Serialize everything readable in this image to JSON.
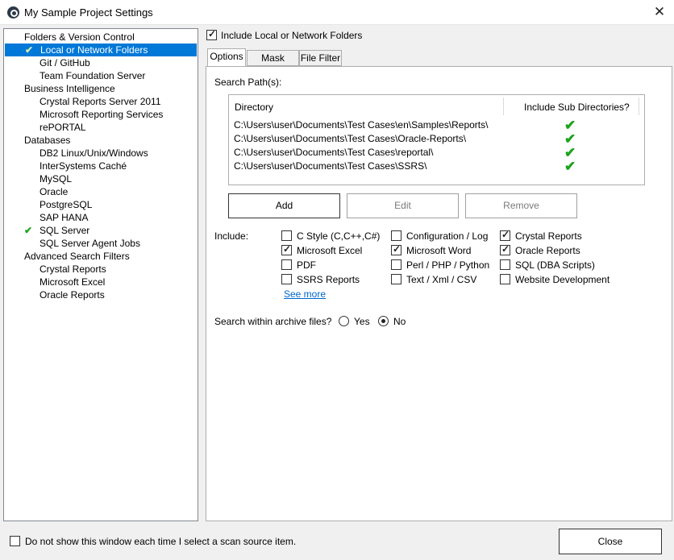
{
  "window": {
    "title": "My Sample Project Settings",
    "close_glyph": "✕"
  },
  "tree": {
    "items": [
      {
        "label": "Folders & Version Control",
        "level": 0,
        "selected": false,
        "checked": false
      },
      {
        "label": "Local or Network Folders",
        "level": 1,
        "selected": true,
        "checked": true
      },
      {
        "label": "Git / GitHub",
        "level": 1,
        "selected": false,
        "checked": false
      },
      {
        "label": "Team Foundation Server",
        "level": 1,
        "selected": false,
        "checked": false
      },
      {
        "label": "Business Intelligence",
        "level": 0,
        "selected": false,
        "checked": false
      },
      {
        "label": "Crystal Reports Server 2011",
        "level": 1,
        "selected": false,
        "checked": false
      },
      {
        "label": "Microsoft Reporting Services",
        "level": 1,
        "selected": false,
        "checked": false
      },
      {
        "label": "rePORTAL",
        "level": 1,
        "selected": false,
        "checked": false
      },
      {
        "label": "Databases",
        "level": 0,
        "selected": false,
        "checked": false
      },
      {
        "label": "DB2 Linux/Unix/Windows",
        "level": 1,
        "selected": false,
        "checked": false
      },
      {
        "label": "InterSystems Caché",
        "level": 1,
        "selected": false,
        "checked": false
      },
      {
        "label": "MySQL",
        "level": 1,
        "selected": false,
        "checked": false
      },
      {
        "label": "Oracle",
        "level": 1,
        "selected": false,
        "checked": false
      },
      {
        "label": "PostgreSQL",
        "level": 1,
        "selected": false,
        "checked": false
      },
      {
        "label": "SAP HANA",
        "level": 1,
        "selected": false,
        "checked": false
      },
      {
        "label": "SQL Server",
        "level": 1,
        "selected": false,
        "checked": true
      },
      {
        "label": "SQL Server Agent Jobs",
        "level": 1,
        "selected": false,
        "checked": false
      },
      {
        "label": "Advanced Search Filters",
        "level": 0,
        "selected": false,
        "checked": false
      },
      {
        "label": "Crystal Reports",
        "level": 1,
        "selected": false,
        "checked": false
      },
      {
        "label": "Microsoft Excel",
        "level": 1,
        "selected": false,
        "checked": false
      },
      {
        "label": "Oracle Reports",
        "level": 1,
        "selected": false,
        "checked": false
      }
    ]
  },
  "include_local": {
    "label": "Include Local or Network Folders",
    "checked": true
  },
  "tabs": [
    {
      "label": "Options",
      "active": true
    },
    {
      "label": "Mask Filters",
      "active": false
    },
    {
      "label": "File Filter",
      "active": false
    }
  ],
  "search_paths": {
    "label": "Search Path(s):",
    "columns": [
      "Directory",
      "Include Sub Directories?"
    ],
    "rows": [
      {
        "path": "C:\\Users\\user\\Documents\\Test Cases\\en\\Samples\\Reports\\",
        "sub": true
      },
      {
        "path": "C:\\Users\\user\\Documents\\Test Cases\\Oracle-Reports\\",
        "sub": true
      },
      {
        "path": "C:\\Users\\user\\Documents\\Test Cases\\reportal\\",
        "sub": true
      },
      {
        "path": "C:\\Users\\user\\Documents\\Test Cases\\SSRS\\",
        "sub": true
      }
    ]
  },
  "buttons": {
    "add": "Add",
    "edit": "Edit",
    "remove": "Remove",
    "close": "Close"
  },
  "include": {
    "label": "Include:",
    "options": [
      {
        "label": "C Style (C,C++,C#)",
        "checked": false
      },
      {
        "label": "Configuration / Log",
        "checked": false
      },
      {
        "label": "Crystal Reports",
        "checked": true
      },
      {
        "label": "Microsoft Excel",
        "checked": true
      },
      {
        "label": "Microsoft Word",
        "checked": true
      },
      {
        "label": "Oracle Reports",
        "checked": true
      },
      {
        "label": "PDF",
        "checked": false
      },
      {
        "label": "Perl / PHP / Python",
        "checked": false
      },
      {
        "label": "SQL (DBA Scripts)",
        "checked": false
      },
      {
        "label": "SSRS Reports",
        "checked": false
      },
      {
        "label": "Text / Xml / CSV",
        "checked": false
      },
      {
        "label": "Website Development",
        "checked": false
      }
    ],
    "see_more": "See more"
  },
  "archive": {
    "label": "Search within archive files?",
    "yes": "Yes",
    "no": "No",
    "selected": "No"
  },
  "footer": {
    "dont_show_label": "Do not show this window each time I select a scan source item.",
    "dont_show_checked": false
  }
}
